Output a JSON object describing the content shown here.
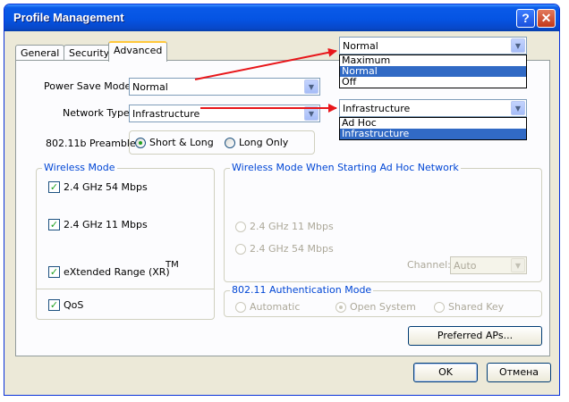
{
  "window": {
    "title": "Profile Management",
    "help_glyph": "?",
    "close_glyph": "✕"
  },
  "tabs": [
    {
      "label": "General"
    },
    {
      "label": "Security"
    },
    {
      "label": "Advanced"
    }
  ],
  "power_save": {
    "label": "Power Save Mode:",
    "value": "Normal"
  },
  "network_type": {
    "label": "Network Type:",
    "value": "Infrastructure"
  },
  "preamble": {
    "label": "802.11b Preamble:",
    "options": [
      {
        "label": "Short & Long",
        "checked": true
      },
      {
        "label": "Long Only",
        "checked": false
      }
    ]
  },
  "wireless_mode": {
    "title": "Wireless Mode",
    "items": [
      {
        "label": "2.4 GHz 54 Mbps",
        "checked": true
      },
      {
        "label": "2.4 GHz 11 Mbps",
        "checked": true
      },
      {
        "label": "eXtended Range (XR)",
        "checked": true
      }
    ],
    "tm": "TM"
  },
  "qos": {
    "label": "QoS",
    "checked": true
  },
  "adhoc_mode": {
    "title": "Wireless Mode When Starting Ad Hoc Network",
    "options": [
      {
        "label": "2.4 GHz 11 Mbps"
      },
      {
        "label": "2.4 GHz 54 Mbps"
      }
    ],
    "channel_label": "Channel:",
    "channel_value": "Auto"
  },
  "auth_mode": {
    "title": "802.11 Authentication Mode",
    "options": [
      {
        "label": "Automatic",
        "checked": false
      },
      {
        "label": "Open System",
        "checked": true
      },
      {
        "label": "Shared Key",
        "checked": false
      }
    ]
  },
  "buttons": {
    "preferred_aps": "Preferred APs...",
    "ok": "OK",
    "cancel": "Отмена"
  },
  "power_dropdown": {
    "value": "Normal",
    "options": [
      {
        "label": "Maximum",
        "selected": false
      },
      {
        "label": "Normal",
        "selected": true
      },
      {
        "label": "Off",
        "selected": false
      }
    ]
  },
  "network_dropdown": {
    "value": "Infrastructure",
    "options": [
      {
        "label": "Ad Hoc",
        "selected": false
      },
      {
        "label": "Infrastructure",
        "selected": true
      }
    ]
  },
  "colors": {
    "arrow": "#e8161a",
    "titlebar": "#0554e3",
    "selection": "#316ac5",
    "group_title": "#0046d5"
  }
}
